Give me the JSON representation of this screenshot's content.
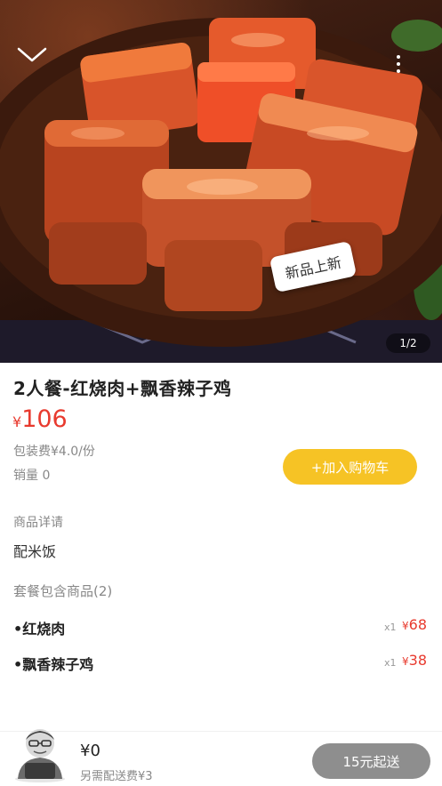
{
  "hero": {
    "badge": "新品上新",
    "pager": "1/2",
    "image_icon": "braised-pork-photo",
    "back_icon": "chevron-down-icon",
    "more_icon": "more-vertical-icon"
  },
  "product": {
    "title": "2人餐-红烧肉+飘香辣子鸡",
    "currency": "¥",
    "price": "106",
    "packing_fee": "包装费¥4.0/份",
    "sales": "销量 0",
    "add_to_cart": "+加入购物车"
  },
  "details": {
    "label": "商品详请",
    "text": "配米饭"
  },
  "combo": {
    "label": "套餐包含商品(2)",
    "items": [
      {
        "name": "•红烧肉",
        "qty": "x1",
        "currency": "¥",
        "price": "68"
      },
      {
        "name": "•飘香辣子鸡",
        "qty": "x1",
        "currency": "¥",
        "price": "38"
      }
    ]
  },
  "cart": {
    "total": "¥0",
    "delivery_fee": "另需配送费¥3",
    "min_order": "15元起送",
    "avatar_icon": "cart-mascot-icon"
  },
  "colors": {
    "price_red": "#e83a2e",
    "cart_yellow": "#f6c325",
    "disabled_gray": "#8e8e8e"
  }
}
